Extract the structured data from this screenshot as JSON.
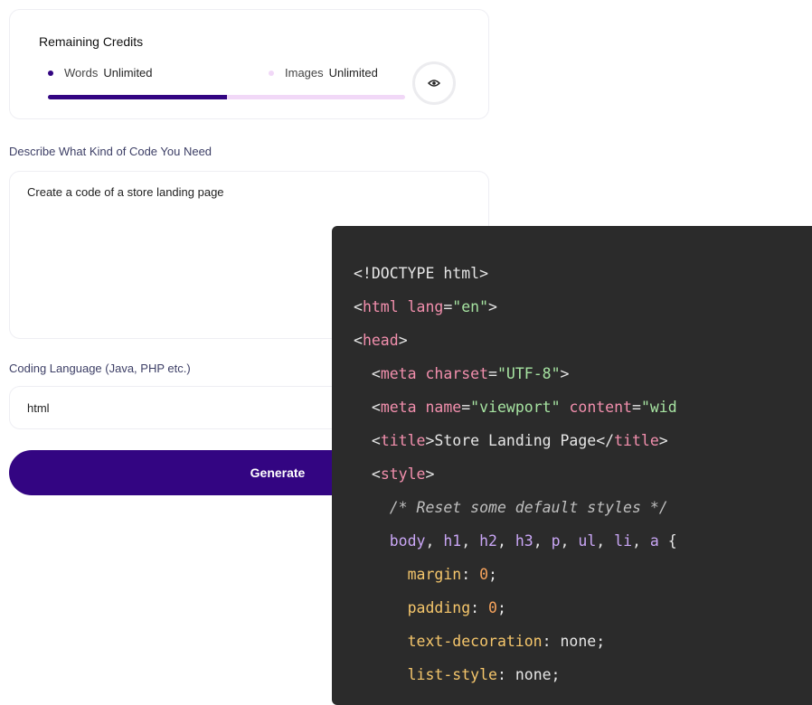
{
  "credits": {
    "title": "Remaining Credits",
    "words_label": "Words",
    "words_value": "Unlimited",
    "images_label": "Images",
    "images_value": "Unlimited",
    "words_color": "#330582",
    "images_color": "#f1d8f7",
    "usage_bar_fraction": 0.5,
    "toggle_icon": "eye-icon"
  },
  "form": {
    "description_label": "Describe What Kind of Code You Need",
    "description_value": "Create a code of a store landing page",
    "language_label": "Coding Language (Java, PHP etc.)",
    "language_value": "html",
    "generate_label": "Generate",
    "generate_color": "#330582"
  },
  "code_output": {
    "background": "#2b2b2b",
    "lines": [
      [
        {
          "t": "<!DOCTYPE html>",
          "c": "default"
        }
      ],
      [
        {
          "t": "<",
          "c": "default"
        },
        {
          "t": "html",
          "c": "tag"
        },
        {
          "t": " lang",
          "c": "attr"
        },
        {
          "t": "=",
          "c": "default"
        },
        {
          "t": "\"en\"",
          "c": "str"
        },
        {
          "t": ">",
          "c": "default"
        }
      ],
      [
        {
          "t": "<",
          "c": "default"
        },
        {
          "t": "head",
          "c": "tag"
        },
        {
          "t": ">",
          "c": "default"
        }
      ],
      [
        {
          "t": "  <",
          "c": "default"
        },
        {
          "t": "meta",
          "c": "tag"
        },
        {
          "t": " charset",
          "c": "attr"
        },
        {
          "t": "=",
          "c": "default"
        },
        {
          "t": "\"UTF-8\"",
          "c": "str"
        },
        {
          "t": ">",
          "c": "default"
        }
      ],
      [
        {
          "t": "  <",
          "c": "default"
        },
        {
          "t": "meta",
          "c": "tag"
        },
        {
          "t": " name",
          "c": "attr"
        },
        {
          "t": "=",
          "c": "default"
        },
        {
          "t": "\"viewport\"",
          "c": "str"
        },
        {
          "t": " content",
          "c": "attr"
        },
        {
          "t": "=",
          "c": "default"
        },
        {
          "t": "\"wid",
          "c": "str"
        }
      ],
      [
        {
          "t": "  <",
          "c": "default"
        },
        {
          "t": "title",
          "c": "tag"
        },
        {
          "t": ">Store Landing Page</",
          "c": "default"
        },
        {
          "t": "title",
          "c": "tag"
        },
        {
          "t": ">",
          "c": "default"
        }
      ],
      [
        {
          "t": "  <",
          "c": "default"
        },
        {
          "t": "style",
          "c": "tag"
        },
        {
          "t": ">",
          "c": "default"
        }
      ],
      [
        {
          "t": "    /* Reset some default styles */",
          "c": "comment"
        }
      ],
      [
        {
          "t": "    body",
          "c": "sel"
        },
        {
          "t": ", ",
          "c": "default"
        },
        {
          "t": "h1",
          "c": "sel"
        },
        {
          "t": ", ",
          "c": "default"
        },
        {
          "t": "h2",
          "c": "sel"
        },
        {
          "t": ", ",
          "c": "default"
        },
        {
          "t": "h3",
          "c": "sel"
        },
        {
          "t": ", ",
          "c": "default"
        },
        {
          "t": "p",
          "c": "sel"
        },
        {
          "t": ", ",
          "c": "default"
        },
        {
          "t": "ul",
          "c": "sel"
        },
        {
          "t": ", ",
          "c": "default"
        },
        {
          "t": "li",
          "c": "sel"
        },
        {
          "t": ", ",
          "c": "default"
        },
        {
          "t": "a",
          "c": "sel"
        },
        {
          "t": " {",
          "c": "default"
        }
      ],
      [
        {
          "t": "      margin",
          "c": "prop"
        },
        {
          "t": ": ",
          "c": "default"
        },
        {
          "t": "0",
          "c": "num"
        },
        {
          "t": ";",
          "c": "default"
        }
      ],
      [
        {
          "t": "      padding",
          "c": "prop"
        },
        {
          "t": ": ",
          "c": "default"
        },
        {
          "t": "0",
          "c": "num"
        },
        {
          "t": ";",
          "c": "default"
        }
      ],
      [
        {
          "t": "      text-decoration",
          "c": "prop"
        },
        {
          "t": ": none;",
          "c": "default"
        }
      ],
      [
        {
          "t": "      list-style",
          "c": "prop"
        },
        {
          "t": ": none;",
          "c": "default"
        }
      ]
    ]
  }
}
